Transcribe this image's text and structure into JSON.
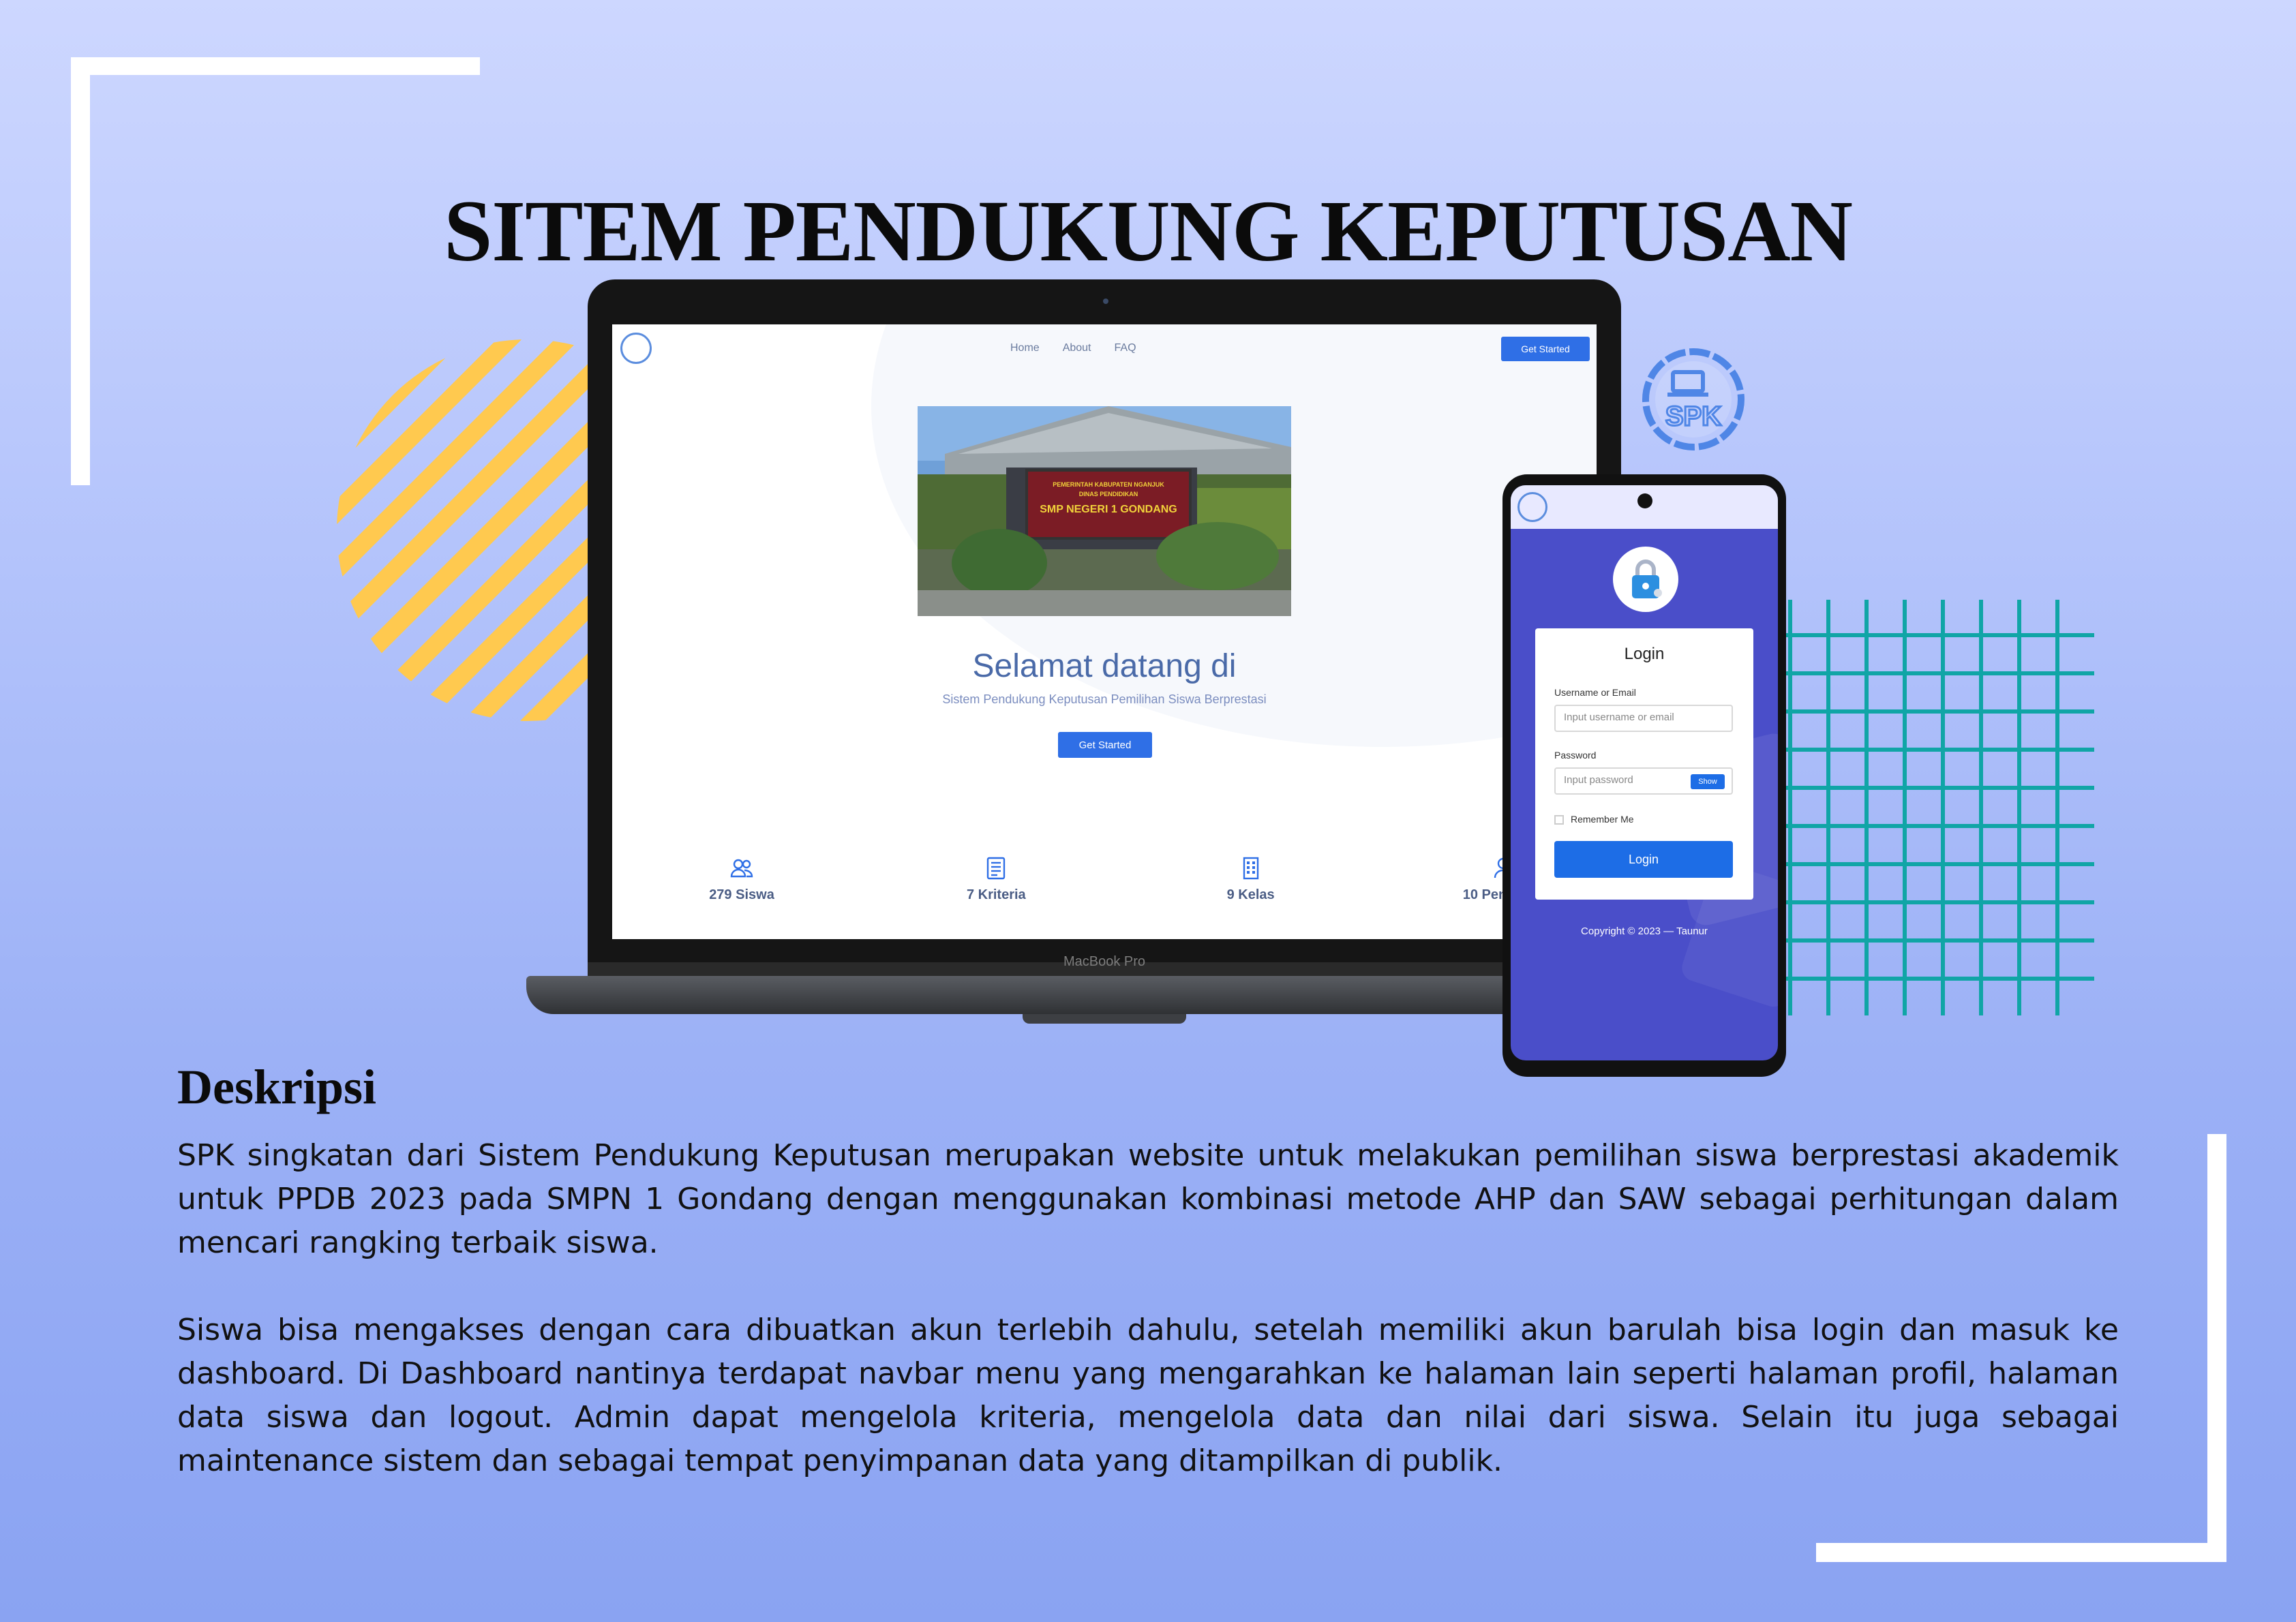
{
  "page": {
    "title": "SITEM PENDUKUNG KEPUTUSAN",
    "logo_text": "SPK"
  },
  "laptop": {
    "label": "MacBook Pro",
    "site": {
      "nav": [
        "Home",
        "About",
        "FAQ"
      ],
      "cta_top": "Get Started",
      "photo_sign": {
        "line1": "PEMERINTAH KABUPATEN NGANJUK",
        "line2": "DINAS PENDIDIKAN",
        "school": "SMP NEGERI 1 GONDANG"
      },
      "hero_title": "Selamat datang di",
      "hero_subtitle": "Sistem Pendukung Keputusan Pemilihan Siswa Berprestasi",
      "hero_cta": "Get Started",
      "stats": [
        {
          "icon": "users-icon",
          "label": "279 Siswa"
        },
        {
          "icon": "document-icon",
          "label": "7 Kriteria"
        },
        {
          "icon": "building-icon",
          "label": "9 Kelas"
        },
        {
          "icon": "user-gear-icon",
          "label": "10 Pengguna"
        }
      ]
    }
  },
  "phone": {
    "login": {
      "title": "Login",
      "username_label": "Username or Email",
      "username_placeholder": "Input username or email",
      "password_label": "Password",
      "password_placeholder": "Input password",
      "show_label": "Show",
      "remember_label": "Remember Me",
      "submit_label": "Login"
    },
    "copyright": "Copyright © 2023 — Taunur"
  },
  "description": {
    "heading": "Deskripsi",
    "paragraph1": "SPK singkatan dari Sistem Pendukung Keputusan merupakan website untuk melakukan pemilihan siswa berprestasi akademik untuk PPDB 2023 pada SMPN 1 Gondang dengan menggunakan kombinasi metode AHP dan SAW sebagai perhitungan dalam mencari rangking terbaik siswa.",
    "paragraph2": "Siswa bisa mengakses dengan cara dibuatkan akun terlebih dahulu, setelah memiliki akun barulah bisa login dan masuk ke dashboard. Di Dashboard nantinya terdapat navbar menu yang mengarahkan ke halaman lain seperti halaman profil, halaman data siswa dan logout. Admin dapat mengelola kriteria, mengelola data dan nilai dari siswa. Selain itu juga sebagai maintenance sistem dan sebagai tempat penyimpanan data yang ditampilkan di publik."
  },
  "colors": {
    "accent": "#2f6fe6",
    "stripes": "#ffc94f",
    "grid": "#10a5a6",
    "phone_bg": "#4a4ec9"
  }
}
